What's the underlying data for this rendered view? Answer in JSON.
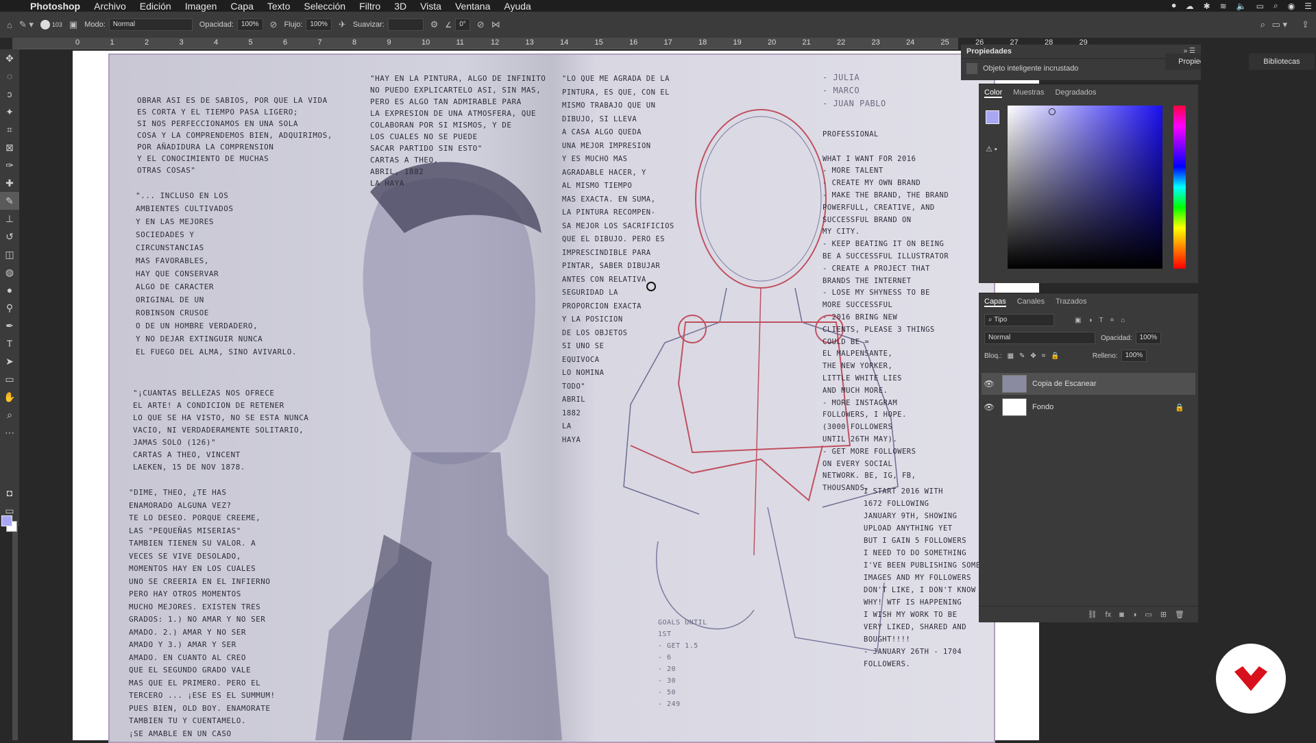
{
  "menubar": {
    "app": "Photoshop",
    "items": [
      "Archivo",
      "Edición",
      "Imagen",
      "Capa",
      "Texto",
      "Selección",
      "Filtro",
      "3D",
      "Vista",
      "Ventana",
      "Ayuda"
    ]
  },
  "options_bar": {
    "brush_size": "103",
    "mode_label": "Modo:",
    "mode_value": "Normal",
    "opacity_label": "Opacidad:",
    "opacity_value": "100%",
    "flow_label": "Flujo:",
    "flow_value": "100%",
    "smooth_label": "Suavizar:",
    "smooth_value": "",
    "angle_value": "0°"
  },
  "ruler": {
    "ticks": [
      "0",
      "1",
      "2",
      "3",
      "4",
      "5",
      "6",
      "7",
      "8",
      "9",
      "10",
      "11",
      "12",
      "13",
      "14",
      "15",
      "16",
      "17",
      "18",
      "19",
      "20",
      "21",
      "22",
      "23",
      "24",
      "25",
      "26",
      "27",
      "28",
      "29"
    ]
  },
  "properties_panel": {
    "title": "Propiedades",
    "subtitle": "Objeto inteligente incrustado",
    "tab_propiedades": "Propiedades",
    "tab_bibliotecas": "Bibliotecas"
  },
  "color_panel": {
    "tabs": [
      "Color",
      "Muestras",
      "Degradados"
    ],
    "fg_color": "#a9a7f4",
    "bg_color": "#ffffff"
  },
  "layers_panel": {
    "tabs": [
      "Capas",
      "Canales",
      "Trazados"
    ],
    "filter": "Tipo",
    "blend": "Normal",
    "opacity_label": "Opacidad:",
    "opacity_value": "100%",
    "lock_label": "Bloq.:",
    "fill_label": "Relleno:",
    "fill_value": "100%",
    "layers": [
      {
        "name": "Copia de Escanear",
        "selected": true
      },
      {
        "name": "Fondo",
        "selected": false
      }
    ]
  },
  "canvas_text": {
    "left_top": "OBRAR ASI ES DE SABIOS, POR QUE LA VIDA\nES CORTA Y EL TIEMPO PASA LIGERO;\nSI NOS PERFECCIONAMOS EN UNA SOLA\nCOSA Y LA COMPRENDEMOS BIEN, ADQUIRIMOS,\nPOR AÑADIDURA LA COMPRENSION\nY EL CONOCIMIENTO DE MUCHAS\nOTRAS COSAS\"",
    "left_mid": "\"... INCLUSO EN LOS\nAMBIENTES CULTIVADOS\nY EN LAS MEJORES\nSOCIEDADES Y\nCIRCUNSTANCIAS\nMAS FAVORABLES,\nHAY QUE CONSERVAR\nALGO DE CARACTER\nORIGINAL DE UN\nROBINSON CRUSOE\nO DE UN HOMBRE VERDADERO,\nY NO DEJAR EXTINGUIR NUNCA\nEL FUEGO DEL ALMA, SINO AVIVARLO.",
    "left_quote2": "\"¡CUANTAS BELLEZAS NOS OFRECE\nEL ARTE! A CONDICION DE RETENER\nLO QUE SE HA VISTO, NO SE ESTA NUNCA\nVACIO, NI VERDADERAMENTE SOLITARIO,\nJAMAS SOLO (126)\"\nCARTAS A THEO, VINCENT\nLAEKEN, 15 DE NOV 1878.",
    "left_bottom": "\"DIME, THEO, ¿TE HAS\nENAMORADO ALGUNA VEZ?\nTE LO DESEO. PORQUE CREEME,\nLAS \"PEQUEÑAS MISERIAS\"\nTAMBIEN TIENEN SU VALOR. A\nVECES SE VIVE DESOLADO,\nMOMENTOS HAY EN LOS CUALES\nUNO SE CREERIA EN EL INFIERNO\nPERO HAY OTROS MOMENTOS\nMUCHO MEJORES. EXISTEN TRES\nGRADOS: 1.) NO AMAR Y NO SER\nAMADO. 2.) AMAR Y NO SER\nAMADO Y 3.) AMAR Y SER\nAMADO. EN CUANTO AL CREO\nQUE EL SEGUNDO GRADO VALE\nMAS QUE EL PRIMERO. PERO EL\nTERCERO ... ¡ESE ES EL SUMMUM!\nPUES BIEN, OLD BOY. ENAMORATE\nTAMBIEN TU Y CUENTAMELO.\n¡SE AMABLE EN UN CASO",
    "mid_top": "\"HAY EN LA PINTURA, ALGO DE INFINITO\nNO PUEDO EXPLICARTELO ASI, SIN MAS,\nPERO ES ALGO TAN ADMIRABLE PARA\nLA EXPRESION DE UNA ATMOSFERA, QUE\nCOLABORAN POR SI MISMOS, Y DE\nLOS CUALES NO SE PUEDE\nSACAR PARTIDO SIN ESTO\"\nCARTAS A THEO,\nABRIL, 1882\nLA HAYA",
    "right_left": "\"LO QUE ME AGRADA DE LA\nPINTURA, ES QUE, CON EL\nMISMO TRABAJO QUE UN\nDIBUJO, SI LLEVA\nA CASA ALGO QUEDA\nUNA MEJOR IMPRESION\nY ES MUCHO MAS\nAGRADABLE HACER, Y\nAL MISMO TIEMPO\nMAS EXACTA. EN SUMA,\nLA PINTURA RECOMPEN-\nSA MEJOR LOS SACRIFICIOS\nQUE EL DIBUJO. PERO ES\nIMPRESCINDIBLE PARA\nPINTAR, SABER DIBUJAR\nANTES CON RELATIVA\nSEGURIDAD LA\nPROPORCION EXACTA\nY LA POSICION\nDE LOS OBJETOS\nSI UNO SE\nEQUIVOCA\nLO NOMINA\nTODO\"\nABRIL\n1882\nLA\nHAYA",
    "names": "- JULIA\n- MARCO\n- JUAN PABLO",
    "right_list": "PROFESSIONAL\n\nWHAT I WANT FOR 2016\n- MORE TALENT\n- CREATE MY OWN BRAND\n- MAKE THE BRAND, THE BRAND\nPOWERFULL, CREATIVE, AND\nSUCCESSFUL BRAND ON\nMY CITY.\n- KEEP BEATING IT ON BEING\nBE A SUCCESSFUL ILLUSTRATOR\n- CREATE A PROJECT THAT\nBRANDS THE INTERNET\n- LOSE MY SHYNESS TO BE\nMORE SUCCESSFUL\n- 2016 BRING NEW\nCLIENTS, PLEASE 3 THINGS\nCOULD BE =\nEL MALPENSANTE,\nTHE NEW YORKER,\nLITTLE WHITE LIES\nAND MUCH MORE.\n- MORE INSTAGRAM\nFOLLOWERS, I HOPE.\n(3000 FOLLOWERS\nUNTIL 26TH MAY).\n- GET MORE FOLLOWERS\nON EVERY SOCIAL\nNETWORK. BE, IG, FB,\nTHOUSANDS.",
    "right_bottom": "I START 2016 WITH\n1672 FOLLOWING\nJANUARY 9TH, SHOWING\nUPLOAD ANYTHING YET\nBUT I GAIN 5 FOLLOWERS\nI NEED TO DO SOMETHING\nI'VE BEEN PUBLISHING SOME\nIMAGES AND MY FOLLOWERS\nDON'T LIKE, I DON'T KNOW\nWHY! WTF IS HAPPENING\nI WISH MY WORK TO BE\nVERY LIKED, SHARED AND\nBOUGHT!!!!\n- JANUARY 26TH - 1704\nFOLLOWERS.",
    "goals": "GOALS UNTIL\n1ST\n- GET 1.5\n- 6\n- 20\n- 30\n- 50\n- 249"
  }
}
